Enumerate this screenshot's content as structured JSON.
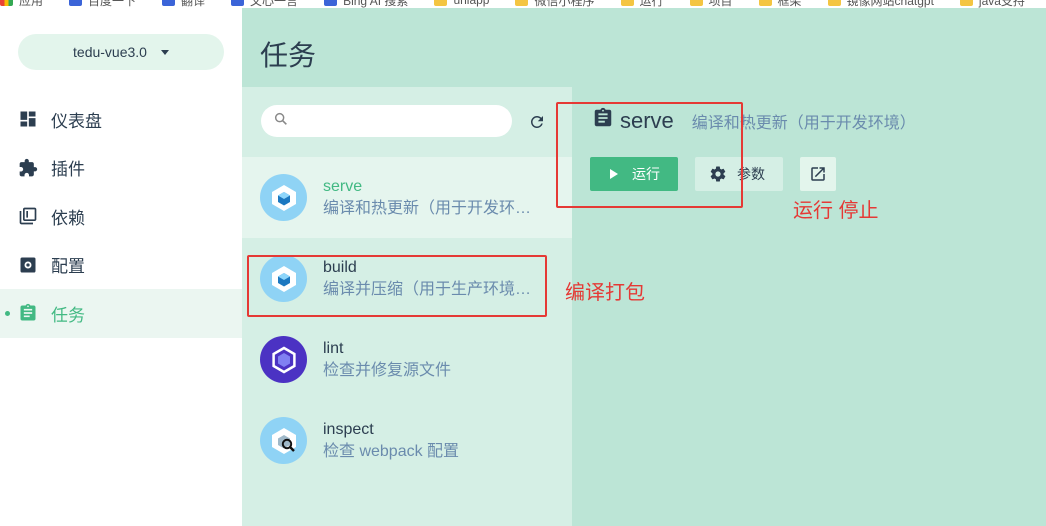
{
  "bookmarks": [
    {
      "label": "应用",
      "icon": "apps-grid-icon"
    },
    {
      "label": "百度一下",
      "icon": "baidu-icon"
    },
    {
      "label": "翻译",
      "icon": "translate-icon"
    },
    {
      "label": "文心一言",
      "icon": "wenxin-icon"
    },
    {
      "label": "Bing AI 搜索",
      "icon": "bing-icon"
    },
    {
      "label": "uniapp",
      "icon": "folder-icon"
    },
    {
      "label": "微信小程序",
      "icon": "folder-icon"
    },
    {
      "label": "运行",
      "icon": "folder-icon"
    },
    {
      "label": "项目",
      "icon": "folder-icon"
    },
    {
      "label": "框架",
      "icon": "folder-icon"
    },
    {
      "label": "镜像网站chatgpt",
      "icon": "folder-icon"
    },
    {
      "label": "java支持",
      "icon": "folder-icon"
    }
  ],
  "project": {
    "name": "tedu-vue3.0"
  },
  "sidebar": {
    "items": [
      {
        "label": "仪表盘",
        "icon": "dashboard-icon",
        "active": false
      },
      {
        "label": "插件",
        "icon": "puzzle-icon",
        "active": false
      },
      {
        "label": "依赖",
        "icon": "library-books-icon",
        "active": false
      },
      {
        "label": "配置",
        "icon": "settings-icon",
        "active": false
      },
      {
        "label": "任务",
        "icon": "assignment-icon",
        "active": true
      }
    ]
  },
  "main": {
    "title": "任务"
  },
  "search": {
    "placeholder": "",
    "value": ""
  },
  "tasks": [
    {
      "name": "serve",
      "description": "编译和热更新（用于开发环…",
      "icon": "webpack-icon",
      "selected": true
    },
    {
      "name": "build",
      "description": "编译并压缩（用于生产环境…",
      "icon": "webpack-icon",
      "selected": false
    },
    {
      "name": "lint",
      "description": "检查并修复源文件",
      "icon": "eslint-icon",
      "selected": false
    },
    {
      "name": "inspect",
      "description": "检查 webpack 配置",
      "icon": "webpack-inspect-icon",
      "selected": false
    }
  ],
  "details": {
    "name": "serve",
    "description": "编译和热更新（用于开发环境）",
    "run_label": "运行",
    "params_label": "参数"
  },
  "annotations": {
    "run_stop": "运行 停止",
    "build_pack": "编译打包",
    "color": "#e53935"
  },
  "colors": {
    "accent": "#42b983",
    "header_bg": "#bce5d6",
    "list_bg": "#d5efe5"
  }
}
